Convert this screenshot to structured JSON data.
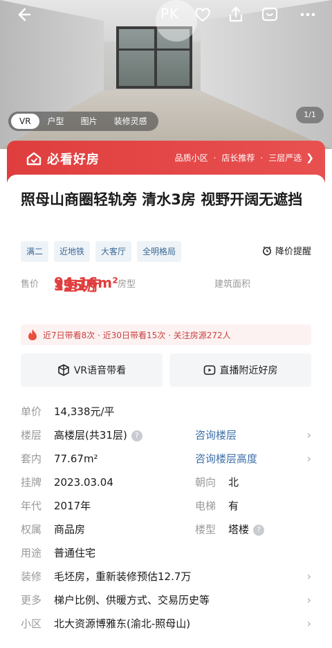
{
  "topbar": {
    "pk_label": "PK"
  },
  "hero": {
    "tabs": [
      "VR",
      "户型",
      "图片",
      "装修灵感"
    ],
    "counter": "1/1"
  },
  "banner": {
    "brand": "必看好房",
    "tags": [
      "品质小区",
      "店长推荐",
      "三层严选"
    ]
  },
  "listing": {
    "title": "照母山商圈轻轨旁  清水3房  视野开阔无遮挡",
    "tags": [
      "满二",
      "近地铁",
      "大客厅",
      "全明格局"
    ],
    "price_alert": "降价提醒",
    "stats": [
      {
        "value": "135万",
        "label": "售价"
      },
      {
        "value": "3室1厅",
        "label": "房型"
      },
      {
        "value": "94.16m²",
        "label": "建筑面积"
      }
    ],
    "hot_info": "近7日带看8次 · 近30日带看15次 · 关注房源272人",
    "actions": {
      "vr_tour": "VR语音带看",
      "live": "直播附近好房"
    }
  },
  "details": {
    "unit_price": {
      "key": "单价",
      "value": "14,338元/平"
    },
    "floor": {
      "key": "楼层",
      "value": "高楼层(共31层)",
      "link": "咨询楼层"
    },
    "inner_area": {
      "key": "套内",
      "value": "77.67m²",
      "link": "咨询楼层高度"
    },
    "listed": {
      "key": "挂牌",
      "value": "2023.03.04"
    },
    "orientation": {
      "key": "朝向",
      "value": "北"
    },
    "year": {
      "key": "年代",
      "value": "2017年"
    },
    "elevator": {
      "key": "电梯",
      "value": "有"
    },
    "ownership": {
      "key": "权属",
      "value": "商品房"
    },
    "building_type": {
      "key": "楼型",
      "value": "塔楼"
    },
    "usage": {
      "key": "用途",
      "value": "普通住宅"
    },
    "decoration": {
      "key": "装修",
      "value": "毛坯房，重新装修预估12.7万"
    },
    "more": {
      "key": "更多",
      "value": "梯户比例、供暖方式、交易历史等"
    },
    "community": {
      "key": "小区",
      "value": "北大资源博雅东(渝北-照母山)"
    }
  }
}
